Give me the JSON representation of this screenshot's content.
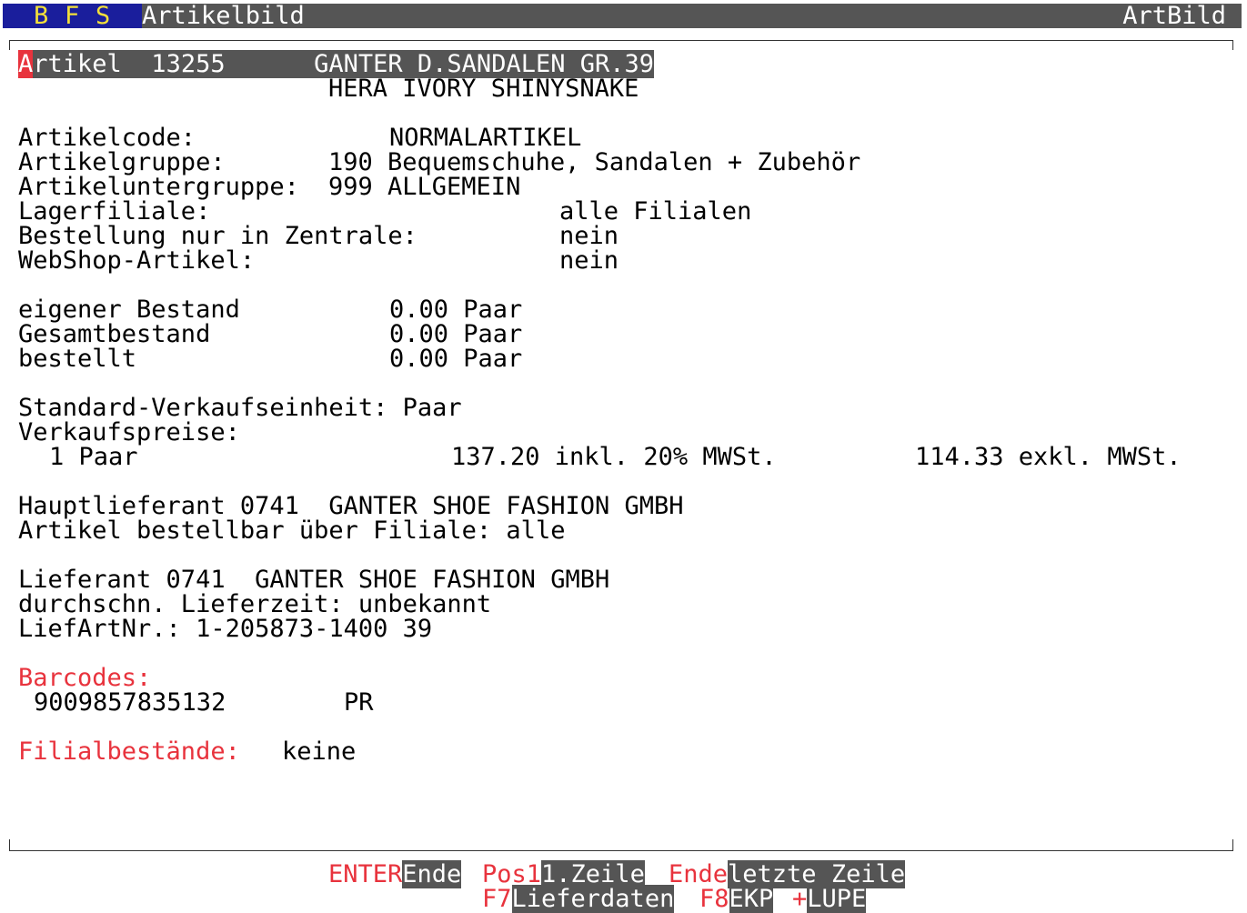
{
  "topbar": {
    "app_letters": [
      "B",
      "F",
      "S"
    ],
    "title": "Artikelbild",
    "right_title": "ArtBild"
  },
  "header": {
    "label_first": "A",
    "label_rest": "rtikel  13255      ",
    "name1": "GANTER D.SANDALEN GR.39",
    "name2": "HERA IVORY SHINYSNAKE"
  },
  "info": {
    "artikelcode_label": "Artikelcode:",
    "artikelcode_value": "NORMALARTIKEL",
    "artikelgruppe_label": "Artikelgruppe:",
    "artikelgruppe_value": "190 Bequemschuhe, Sandalen + Zubehör",
    "untergruppe_label": "Artikeluntergruppe:",
    "untergruppe_value": "999 ALLGEMEIN",
    "lagerfiliale_label": "Lagerfiliale:",
    "lagerfiliale_value": "alle Filialen",
    "bestellung_label": "Bestellung nur in Zentrale:",
    "bestellung_value": "nein",
    "webshop_label": "WebShop-Artikel:",
    "webshop_value": "nein"
  },
  "stock": {
    "eigener_label": "eigener Bestand",
    "eigener_value": "0.00 Paar",
    "gesamt_label": "Gesamtbestand",
    "gesamt_value": "0.00 Paar",
    "bestellt_label": "bestellt",
    "bestellt_value": "0.00 Paar"
  },
  "prices": {
    "unit_line": "Standard-Verkaufseinheit: Paar",
    "label": "Verkaufspreise:",
    "qty": "1 Paar",
    "gross": "137.20 inkl. 20% MWSt.",
    "net": "114.33 exkl. MWSt."
  },
  "supplier": {
    "haupt": "Hauptlieferant 0741  GANTER SHOE FASHION GMBH",
    "bestellbar": "Artikel bestellbar über Filiale: alle",
    "lieferant": "Lieferant 0741  GANTER SHOE FASHION GMBH",
    "lieferzeit": "durchschn. Lieferzeit: unbekannt",
    "liefartnr": "LiefArtNr.: 1-205873-1400 39"
  },
  "barcodes": {
    "label": "Barcodes:",
    "code": "9009857835132",
    "unit": "PR"
  },
  "filial": {
    "label": "Filialbestände:",
    "value": "keine"
  },
  "footer": {
    "row1": [
      {
        "key": "ENTER",
        "label": "Ende"
      },
      {
        "key": "Pos1",
        "label": "1.Zeile"
      },
      {
        "key": "Ende",
        "label": "letzte Zeile"
      }
    ],
    "row2": [
      {
        "key": "F7",
        "label": "Lieferdaten"
      },
      {
        "key": "F8",
        "label": "EKP"
      },
      {
        "key": "+",
        "label": "LUPE"
      }
    ]
  },
  "colors": {
    "accent_red": "#e8333d",
    "highlight_gray": "#555555",
    "title_blue": "#1a1e9c",
    "title_yellow": "#f3e03a"
  }
}
